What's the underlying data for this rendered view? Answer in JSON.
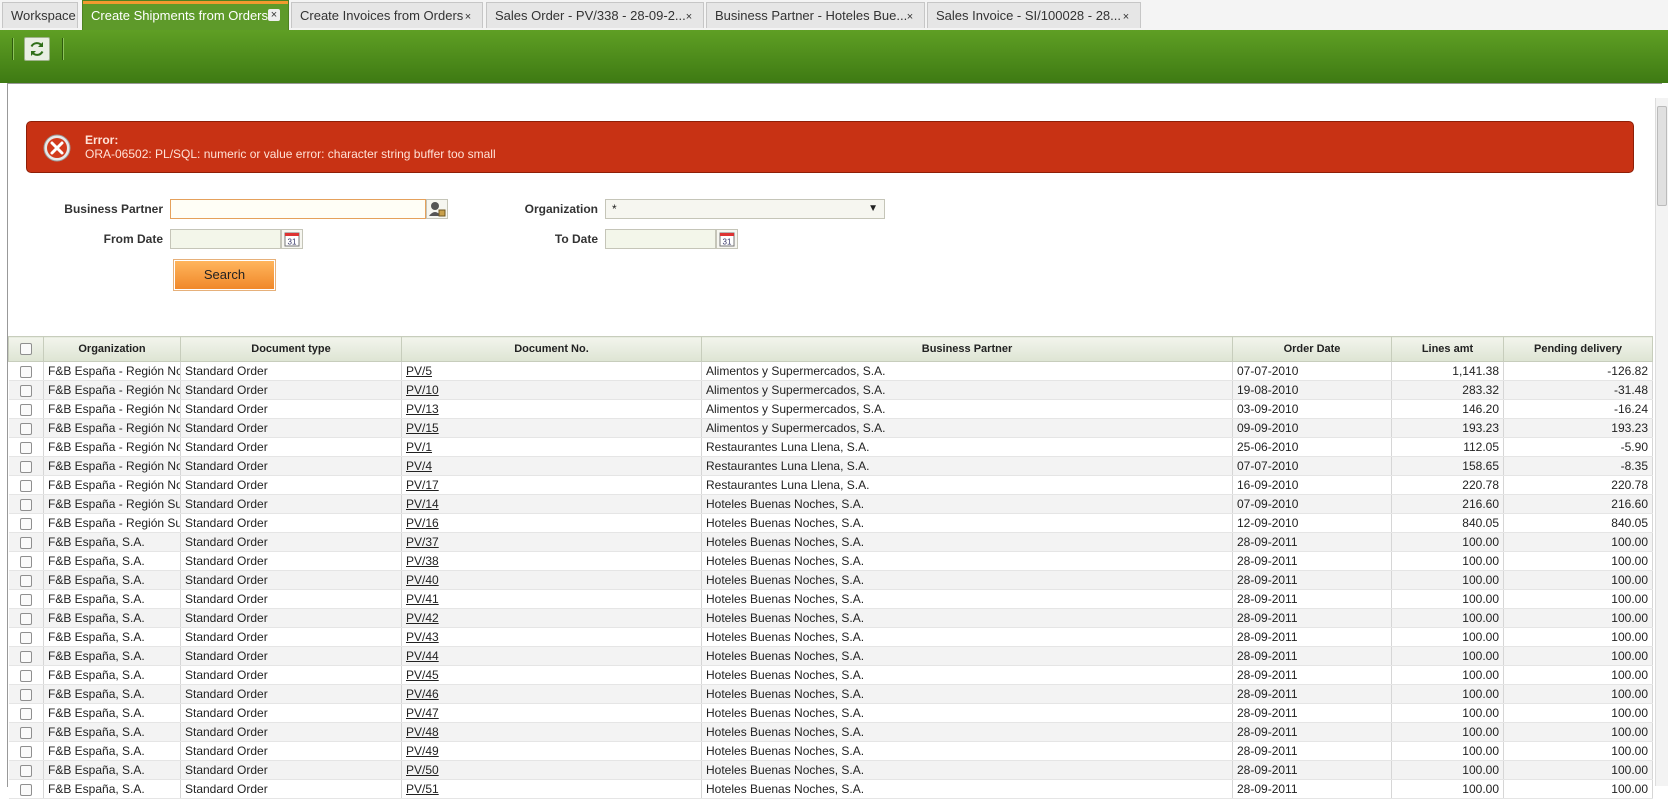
{
  "tabs": [
    {
      "label": "Workspace",
      "closable": false
    },
    {
      "label": "Create Shipments from Orders",
      "closable": true,
      "active": true
    },
    {
      "label": "Create Invoices from Orders",
      "closable": true
    },
    {
      "label": "Sales Order - PV/338 - 28-09-2...",
      "closable": true
    },
    {
      "label": "Business Partner - Hoteles Bue...",
      "closable": true
    },
    {
      "label": "Sales Invoice - SI/100028 - 28...",
      "closable": true
    }
  ],
  "toolbar": {
    "refresh_icon": "refresh-icon"
  },
  "error": {
    "title": "Error:",
    "message": "ORA-06502: PL/SQL: numeric or value error: character string buffer too small"
  },
  "form": {
    "business_partner_label": "Business Partner",
    "business_partner_value": "",
    "organization_label": "Organization",
    "organization_value": "*",
    "from_date_label": "From Date",
    "from_date_value": "",
    "to_date_label": "To Date",
    "to_date_value": "",
    "calendar_text": "31",
    "search_label": "Search"
  },
  "grid": {
    "columns": [
      "Organization",
      "Document type",
      "Document No.",
      "Business Partner",
      "Order Date",
      "Lines amt",
      "Pending delivery"
    ],
    "rows": [
      [
        "F&B España - Región Norte",
        "Standard Order",
        "PV/5",
        "Alimentos y Supermercados, S.A.",
        "07-07-2010",
        "1,141.38",
        "-126.82"
      ],
      [
        "F&B España - Región Norte",
        "Standard Order",
        "PV/10",
        "Alimentos y Supermercados, S.A.",
        "19-08-2010",
        "283.32",
        "-31.48"
      ],
      [
        "F&B España - Región Norte",
        "Standard Order",
        "PV/13",
        "Alimentos y Supermercados, S.A.",
        "03-09-2010",
        "146.20",
        "-16.24"
      ],
      [
        "F&B España - Región Norte",
        "Standard Order",
        "PV/15",
        "Alimentos y Supermercados, S.A.",
        "09-09-2010",
        "193.23",
        "193.23"
      ],
      [
        "F&B España - Región Norte",
        "Standard Order",
        "PV/1",
        "Restaurantes Luna Llena, S.A.",
        "25-06-2010",
        "112.05",
        "-5.90"
      ],
      [
        "F&B España - Región Norte",
        "Standard Order",
        "PV/4",
        "Restaurantes Luna Llena, S.A.",
        "07-07-2010",
        "158.65",
        "-8.35"
      ],
      [
        "F&B España - Región Norte",
        "Standard Order",
        "PV/17",
        "Restaurantes Luna Llena, S.A.",
        "16-09-2010",
        "220.78",
        "220.78"
      ],
      [
        "F&B España - Región Sur",
        "Standard Order",
        "PV/14",
        "Hoteles Buenas Noches, S.A.",
        "07-09-2010",
        "216.60",
        "216.60"
      ],
      [
        "F&B España - Región Sur",
        "Standard Order",
        "PV/16",
        "Hoteles Buenas Noches, S.A.",
        "12-09-2010",
        "840.05",
        "840.05"
      ],
      [
        "F&B España, S.A.",
        "Standard Order",
        "PV/37",
        "Hoteles Buenas Noches, S.A.",
        "28-09-2011",
        "100.00",
        "100.00"
      ],
      [
        "F&B España, S.A.",
        "Standard Order",
        "PV/38",
        "Hoteles Buenas Noches, S.A.",
        "28-09-2011",
        "100.00",
        "100.00"
      ],
      [
        "F&B España, S.A.",
        "Standard Order",
        "PV/40",
        "Hoteles Buenas Noches, S.A.",
        "28-09-2011",
        "100.00",
        "100.00"
      ],
      [
        "F&B España, S.A.",
        "Standard Order",
        "PV/41",
        "Hoteles Buenas Noches, S.A.",
        "28-09-2011",
        "100.00",
        "100.00"
      ],
      [
        "F&B España, S.A.",
        "Standard Order",
        "PV/42",
        "Hoteles Buenas Noches, S.A.",
        "28-09-2011",
        "100.00",
        "100.00"
      ],
      [
        "F&B España, S.A.",
        "Standard Order",
        "PV/43",
        "Hoteles Buenas Noches, S.A.",
        "28-09-2011",
        "100.00",
        "100.00"
      ],
      [
        "F&B España, S.A.",
        "Standard Order",
        "PV/44",
        "Hoteles Buenas Noches, S.A.",
        "28-09-2011",
        "100.00",
        "100.00"
      ],
      [
        "F&B España, S.A.",
        "Standard Order",
        "PV/45",
        "Hoteles Buenas Noches, S.A.",
        "28-09-2011",
        "100.00",
        "100.00"
      ],
      [
        "F&B España, S.A.",
        "Standard Order",
        "PV/46",
        "Hoteles Buenas Noches, S.A.",
        "28-09-2011",
        "100.00",
        "100.00"
      ],
      [
        "F&B España, S.A.",
        "Standard Order",
        "PV/47",
        "Hoteles Buenas Noches, S.A.",
        "28-09-2011",
        "100.00",
        "100.00"
      ],
      [
        "F&B España, S.A.",
        "Standard Order",
        "PV/48",
        "Hoteles Buenas Noches, S.A.",
        "28-09-2011",
        "100.00",
        "100.00"
      ],
      [
        "F&B España, S.A.",
        "Standard Order",
        "PV/49",
        "Hoteles Buenas Noches, S.A.",
        "28-09-2011",
        "100.00",
        "100.00"
      ],
      [
        "F&B España, S.A.",
        "Standard Order",
        "PV/50",
        "Hoteles Buenas Noches, S.A.",
        "28-09-2011",
        "100.00",
        "100.00"
      ],
      [
        "F&B España, S.A.",
        "Standard Order",
        "PV/51",
        "Hoteles Buenas Noches, S.A.",
        "28-09-2011",
        "100.00",
        "100.00"
      ]
    ]
  },
  "colors": {
    "toolbar_green": "#4f8c1b",
    "error_red": "#c83214",
    "search_orange": "#f0882a",
    "active_tab": "#5e9a2a"
  }
}
